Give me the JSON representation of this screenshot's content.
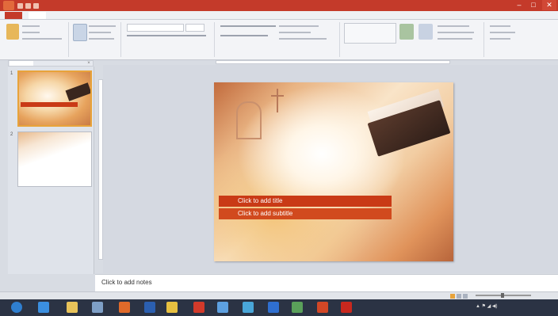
{
  "window": {
    "title": "",
    "minimize": "–",
    "maximize": "□",
    "close": "✕"
  },
  "ribbon": {
    "file_tab": "",
    "tabs": [
      "",
      "",
      "",
      "",
      "",
      "",
      "",
      ""
    ]
  },
  "panel": {
    "tab_slides": "",
    "tab_outline": "",
    "close": "×",
    "thumbnails": [
      {
        "number": "1",
        "selected": true
      },
      {
        "number": "2",
        "selected": false
      }
    ]
  },
  "slide": {
    "title_placeholder": "Click to add title",
    "subtitle_placeholder": "Click to add subtitle"
  },
  "notes": {
    "placeholder": "Click to add notes"
  },
  "status": {
    "slide_info": "",
    "theme": ""
  },
  "taskbar": {
    "apps": [
      {
        "icon": "windows-start-icon",
        "color": "#2f7fd0"
      },
      {
        "icon": "internet-explorer-icon",
        "color": "#3b8fe0"
      },
      {
        "icon": "file-explorer-icon",
        "color": "#e8c35a"
      },
      {
        "icon": "media-player-icon",
        "color": "#7e9fc6"
      },
      {
        "icon": "firefox-icon",
        "color": "#e06a2a"
      },
      {
        "icon": "word-icon",
        "color": "#2b5fb0"
      },
      {
        "icon": "chrome-icon",
        "color": "#e7c040"
      },
      {
        "icon": "opera-icon",
        "color": "#d23a2a"
      },
      {
        "icon": "network-icon",
        "color": "#5da0e0"
      },
      {
        "icon": "app-icon",
        "color": "#49a6d8"
      },
      {
        "icon": "bluetooth-icon",
        "color": "#2f6fd0"
      },
      {
        "icon": "photo-icon",
        "color": "#5aa05a"
      },
      {
        "icon": "powerpoint-icon",
        "color": "#d24726"
      },
      {
        "icon": "pdf-icon",
        "color": "#c8281e"
      }
    ],
    "clock_time": "",
    "clock_date": ""
  },
  "colors": {
    "accent": "#c43a2a",
    "selection": "#e8a33a"
  }
}
